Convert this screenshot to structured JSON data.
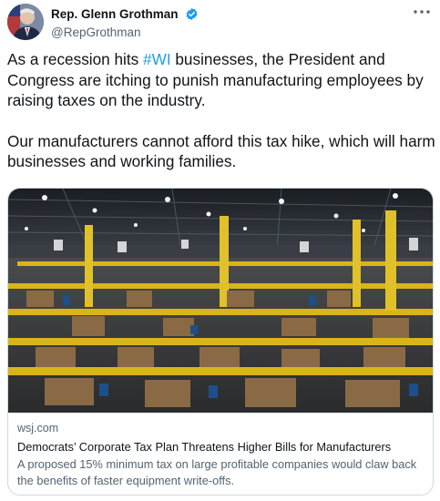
{
  "author": {
    "display_name": "Rep. Glenn Grothman",
    "handle": "@RepGrothman",
    "verified_icon": "verified-badge-icon",
    "avatar_icon": "profile-photo"
  },
  "more_icon": "more-options-icon",
  "tweet": {
    "p1_before": "As a recession hits ",
    "hashtag": "#WI",
    "p1_after": " businesses, the President and Congress are itching to punish manufacturing employees by raising taxes on the industry.",
    "p2": "Our manufacturers cannot afford this tax hike, which will harm businesses and working families."
  },
  "card": {
    "image_icon": "warehouse-photo",
    "domain": "wsj.com",
    "title": "Democrats’ Corporate Tax Plan Threatens Higher Bills for Manufacturers",
    "description": "A proposed 15% minimum tax on large profitable companies would claw back the benefits of faster equipment write-offs."
  },
  "colors": {
    "link_blue": "#1d9bf0",
    "text": "#0f1419",
    "secondary_text": "#536471",
    "border": "#cfd9de"
  }
}
